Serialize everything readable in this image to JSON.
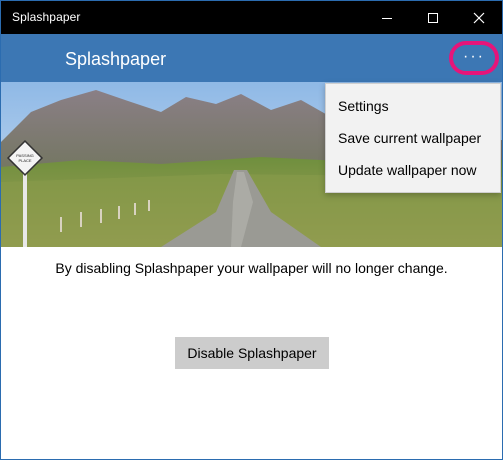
{
  "window": {
    "title": "Splashpaper",
    "controls": {
      "minimize_icon": "minimize-icon",
      "maximize_icon": "maximize-icon",
      "close_icon": "close-icon"
    }
  },
  "appbar": {
    "title": "Splashpaper",
    "more_icon": "more-ellipsis-icon",
    "more_label": "···",
    "highlight_color": "#e5157a",
    "background_color": "#3c77b4"
  },
  "hero": {
    "sign_text_line1": "PASSING",
    "sign_text_line2": "PLACE"
  },
  "menu": {
    "items": [
      {
        "label": "Settings"
      },
      {
        "label": "Save current wallpaper"
      },
      {
        "label": "Update wallpaper now"
      }
    ]
  },
  "main": {
    "message": "By disabling Splashpaper your wallpaper will no longer change.",
    "disable_label": "Disable Splashpaper"
  }
}
